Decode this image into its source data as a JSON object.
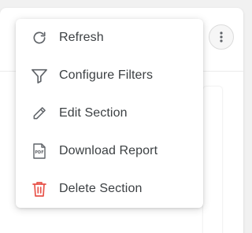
{
  "menu": {
    "items": [
      {
        "label": "Refresh",
        "icon": "refresh-icon"
      },
      {
        "label": "Configure Filters",
        "icon": "filter-icon"
      },
      {
        "label": "Edit Section",
        "icon": "pencil-icon"
      },
      {
        "label": "Download Report",
        "icon": "pdf-file-icon"
      },
      {
        "label": "Delete Section",
        "icon": "trash-icon"
      }
    ]
  },
  "icons": {
    "pdf_text": "PDF"
  },
  "colors": {
    "text": "#3c4043",
    "icon": "#5f6368",
    "danger": "#e8534a"
  }
}
